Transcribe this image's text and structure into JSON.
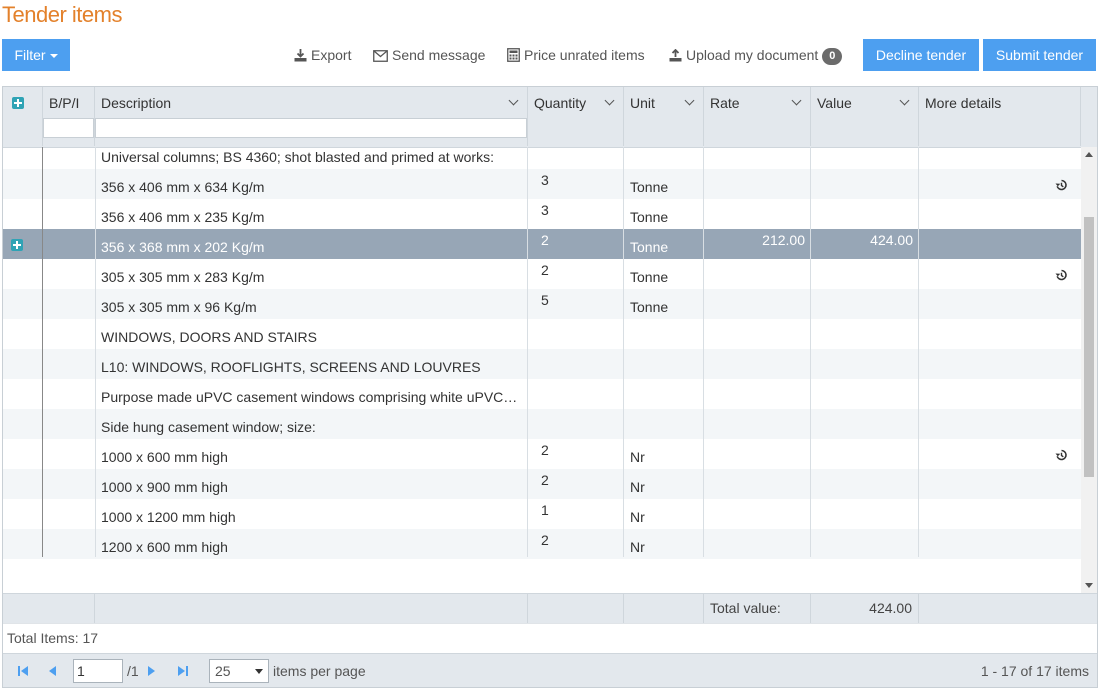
{
  "page": {
    "title": "Tender items"
  },
  "toolbar": {
    "filter_label": "Filter",
    "export_label": "Export",
    "send_message_label": "Send message",
    "price_unrated_label": "Price unrated items",
    "upload_label": "Upload my document",
    "upload_count": "0",
    "decline_label": "Decline tender",
    "submit_label": "Submit tender"
  },
  "grid": {
    "columns": [
      "B/P/I",
      "Description",
      "Quantity",
      "Unit",
      "Rate",
      "Value",
      "More details"
    ],
    "rows": [
      {
        "description": "Universal columns; BS 4360; shot blasted and primed at works:",
        "quantity": "",
        "unit": "",
        "rate": "",
        "value": "",
        "history_icon": false,
        "selected": false
      },
      {
        "description": "356 x 406 mm x 634 Kg/m",
        "quantity": "3",
        "unit": "Tonne",
        "rate": "",
        "value": "",
        "history_icon": true,
        "selected": false
      },
      {
        "description": "356 x 406 mm x 235 Kg/m",
        "quantity": "3",
        "unit": "Tonne",
        "rate": "",
        "value": "",
        "history_icon": false,
        "selected": false
      },
      {
        "description": "356 x 368 mm x 202 Kg/m",
        "quantity": "2",
        "unit": "Tonne",
        "rate": "212.00",
        "value": "424.00",
        "history_icon": false,
        "selected": true
      },
      {
        "description": "305 x 305 mm x 283 Kg/m",
        "quantity": "2",
        "unit": "Tonne",
        "rate": "",
        "value": "",
        "history_icon": true,
        "selected": false
      },
      {
        "description": "305 x 305 mm x 96 Kg/m",
        "quantity": "5",
        "unit": "Tonne",
        "rate": "",
        "value": "",
        "history_icon": false,
        "selected": false
      },
      {
        "description": "WINDOWS, DOORS AND STAIRS",
        "quantity": "",
        "unit": "",
        "rate": "",
        "value": "",
        "history_icon": false,
        "selected": false
      },
      {
        "description": "L10: WINDOWS, ROOFLIGHTS, SCREENS AND LOUVRES",
        "quantity": "",
        "unit": "",
        "rate": "",
        "value": "",
        "history_icon": false,
        "selected": false
      },
      {
        "description": "Purpose made uPVC casement windows comprising white uPVC…",
        "quantity": "",
        "unit": "",
        "rate": "",
        "value": "",
        "history_icon": false,
        "selected": false
      },
      {
        "description": "Side hung casement window; size:",
        "quantity": "",
        "unit": "",
        "rate": "",
        "value": "",
        "history_icon": false,
        "selected": false
      },
      {
        "description": "1000 x 600 mm high",
        "quantity": "2",
        "unit": "Nr",
        "rate": "",
        "value": "",
        "history_icon": true,
        "selected": false
      },
      {
        "description": "1000 x 900 mm high",
        "quantity": "2",
        "unit": "Nr",
        "rate": "",
        "value": "",
        "history_icon": false,
        "selected": false
      },
      {
        "description": "1000 x 1200 mm high",
        "quantity": "1",
        "unit": "Nr",
        "rate": "",
        "value": "",
        "history_icon": false,
        "selected": false
      },
      {
        "description": "1200 x 600 mm high",
        "quantity": "2",
        "unit": "Nr",
        "rate": "",
        "value": "",
        "history_icon": false,
        "selected": false
      }
    ],
    "footer": {
      "total_label": "Total value:",
      "total_value": "424.00"
    },
    "status": {
      "total_items": "Total Items: 17"
    }
  },
  "pager": {
    "current_page": "1",
    "page_count": "/1",
    "page_size": "25",
    "per_page_label": "items per page",
    "range_text": "1 - 17 of 17 items"
  },
  "colors": {
    "accent": "#4d9ff0",
    "title": "#e3812b",
    "selected_row": "#97a6b6",
    "header_bg": "#e3e8ed"
  }
}
